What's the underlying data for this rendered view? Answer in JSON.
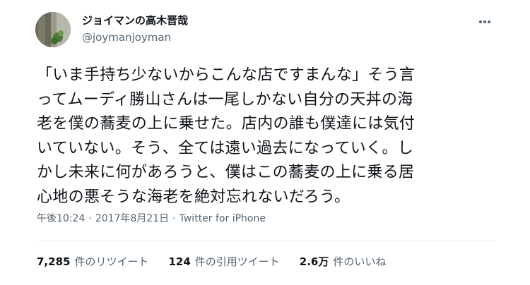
{
  "author": {
    "display_name": "ジョイマンの高木晋哉",
    "handle": "@joymanjoyman",
    "avatar_icon": "avatar-photo"
  },
  "menu": {
    "more_icon": "more-icon"
  },
  "tweet": {
    "text": "「いま手持ち少ないからこんな店ですまんな」そう言\nってムーディ勝山さんは一尾しかない自分の天丼の海\n老を僕の蕎麦の上に乗せた。店内の誰も僕達には気付\nいていない。そう、全ては遠い過去になっていく。し\nかし未来に何があろうと、僕はこの蕎麦の上に乗る居\n心地の悪そうな海老を絶対忘れないだろう。"
  },
  "meta": {
    "time": "午後10:24",
    "separator": "·",
    "date": "2017年8月21日",
    "source": "Twitter for iPhone"
  },
  "stats": {
    "retweets": {
      "count": "7,285",
      "label": "件のリツイート"
    },
    "quotes": {
      "count": "124",
      "label": "件の引用ツイート"
    },
    "likes": {
      "count": "2.6万",
      "label": "件のいいね"
    }
  },
  "colors": {
    "text": "#0f1419",
    "secondary": "#536471",
    "divider": "#eff3f4",
    "background": "#ffffff"
  }
}
